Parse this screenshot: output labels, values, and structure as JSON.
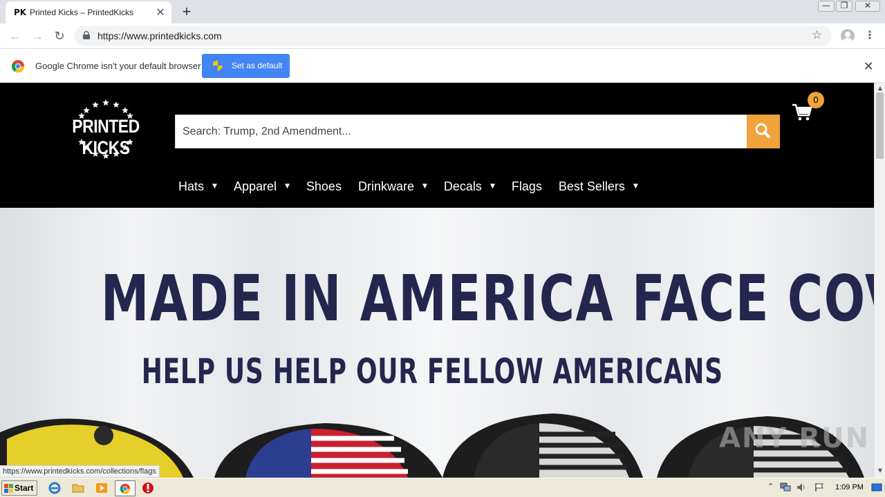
{
  "browser": {
    "tab": {
      "favicon_text": "PK",
      "title": "Printed Kicks – PrintedKicks",
      "close_glyph": "✕"
    },
    "new_tab_glyph": "+",
    "window_controls": {
      "minimize": "—",
      "restore": "❐",
      "close": "✕"
    },
    "url": "https://www.printedkicks.com",
    "nav": {
      "back": "←",
      "forward": "→",
      "reload": "↻"
    },
    "bookmark_glyph": "☆",
    "menu_glyph": "⋮",
    "infobar": {
      "message": "Google Chrome isn't your default browser",
      "button": "Set as default",
      "close_glyph": "✕"
    },
    "status_link": "https://www.printedkicks.com/collections/flags"
  },
  "site": {
    "logo_text": "PRINTED KICKS",
    "search": {
      "placeholder": "Search: Trump, 2nd Amendment..."
    },
    "cart_count": "0",
    "nav": [
      {
        "label": "Hats",
        "dropdown": true
      },
      {
        "label": "Apparel",
        "dropdown": true
      },
      {
        "label": "Shoes",
        "dropdown": false
      },
      {
        "label": "Drinkware",
        "dropdown": true
      },
      {
        "label": "Decals",
        "dropdown": true
      },
      {
        "label": "Flags",
        "dropdown": false
      },
      {
        "label": "Best Sellers",
        "dropdown": true
      }
    ],
    "caret_glyph": "▼",
    "hero": {
      "headline": "MADE IN AMERICA FACE COVERS",
      "subheadline": "HELP US HELP OUR FELLOW AMERICANS"
    },
    "colors": {
      "accent": "#f0a23b",
      "header_bg": "#000000",
      "hero_text": "#25264d"
    }
  },
  "watermark": "ANY RUN",
  "taskbar": {
    "start_label": "Start",
    "clock": "1:09 PM"
  },
  "icons": [
    "chrome-icon",
    "lock-icon",
    "star-icon",
    "profile-icon",
    "shield-icon",
    "search-icon",
    "cart-icon",
    "windows-flag-icon",
    "ie-icon",
    "folder-icon",
    "media-player-icon",
    "opera-icon"
  ]
}
